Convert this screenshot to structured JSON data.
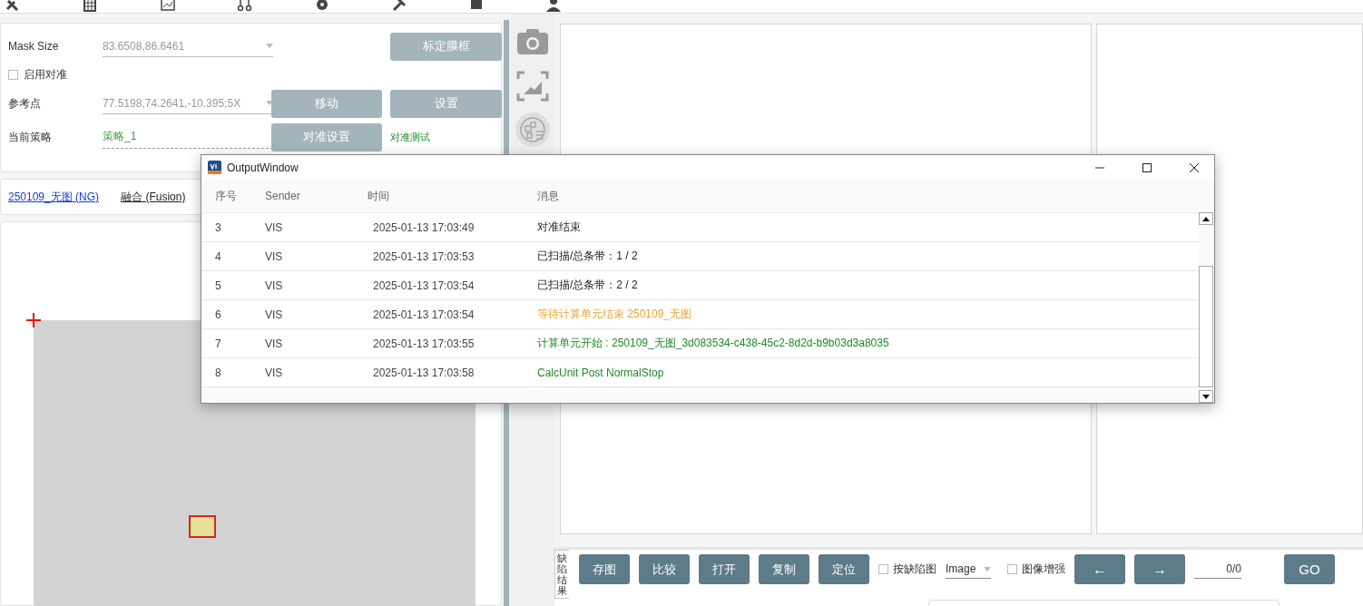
{
  "toolbar": {
    "items": [
      {
        "kind": "tools"
      },
      {
        "kind": "grid"
      },
      {
        "kind": "map"
      },
      {
        "kind": "nodes"
      },
      {
        "kind": "gear"
      },
      {
        "kind": "wrench"
      },
      {
        "kind": "database"
      },
      {
        "kind": "user"
      }
    ]
  },
  "align_panel": {
    "mask_size": {
      "label": "Mask Size",
      "value": "83.6508,86.6461"
    },
    "calibrate_button": {
      "label": "标定膜框",
      "disabled": true
    },
    "enable_align": {
      "label": "启用对准",
      "checked": false
    },
    "reference_point": {
      "label": "参考点",
      "value": "77.5198,74.2641,-10.395;5X"
    },
    "move_button": {
      "label": "移动",
      "disabled": true
    },
    "settings_button": {
      "label": "设置",
      "disabled": true
    },
    "strategy": {
      "label": "当前策略",
      "value": "策略_1"
    },
    "align_settings_button": {
      "label": "对准设置",
      "disabled": true
    },
    "align_test_link": "对准测试"
  },
  "result_links": [
    {
      "text": "250109_无图 (NG)",
      "color": "#1a3ccf"
    },
    {
      "text": "融合 (Fusion)",
      "color": "#222222"
    }
  ],
  "side_tools": [
    {
      "kind": "camera"
    },
    {
      "kind": "capture"
    },
    {
      "kind": "map"
    }
  ],
  "output_window": {
    "title": "OutputWindow",
    "columns": [
      "序号",
      "Sender",
      "时间",
      "消息"
    ],
    "rows": [
      {
        "no": "3",
        "sender": "VIS",
        "time": "2025-01-13 17:03:49",
        "message": "对准结束",
        "kind": "info"
      },
      {
        "no": "4",
        "sender": "VIS",
        "time": "2025-01-13 17:03:53",
        "message": "已扫描/总条带：1 / 2",
        "kind": "info"
      },
      {
        "no": "5",
        "sender": "VIS",
        "time": "2025-01-13 17:03:54",
        "message": "已扫描/总条带：2 / 2",
        "kind": "info"
      },
      {
        "no": "6",
        "sender": "VIS",
        "time": "2025-01-13 17:03:54",
        "message": "等待计算单元结束 250109_无图",
        "kind": "warning"
      },
      {
        "no": "7",
        "sender": "VIS",
        "time": "2025-01-13 17:03:55",
        "message": "计算单元开始 : 250109_无图_3d083534-c438-45c2-8d2d-b9b03d3a8035",
        "kind": "success"
      },
      {
        "no": "8",
        "sender": "VIS",
        "time": "2025-01-13 17:03:58",
        "message": "CalcUnit Post NormalStop",
        "kind": "success"
      }
    ]
  },
  "bottom_bar": {
    "vertical_tabs": [
      {
        "label": "缺陷结果",
        "selected": true
      }
    ],
    "buttons": [
      "存图",
      "比较",
      "打开",
      "复制",
      "定位"
    ],
    "by_defect_checkbox": {
      "label": "按缺陷图",
      "checked": false
    },
    "image_dropdown": {
      "value": "Image"
    },
    "enhance_checkbox": {
      "label": "图像增强",
      "checked": false
    },
    "nav_buttons": [
      "←",
      "→"
    ],
    "page_field": {
      "value": "0/0"
    },
    "go_button": "GO"
  }
}
